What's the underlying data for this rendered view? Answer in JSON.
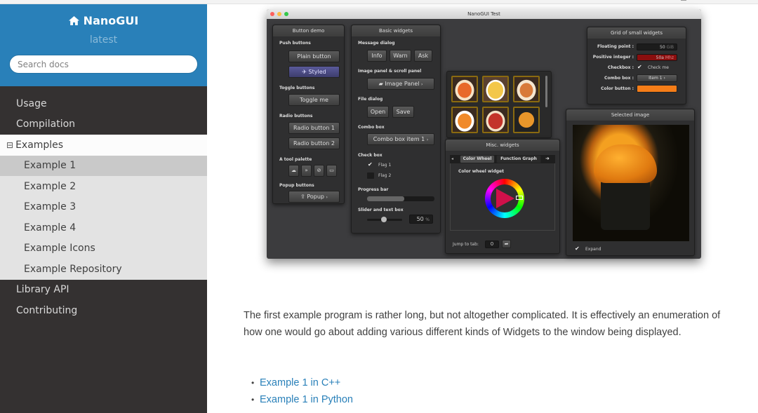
{
  "sidebar": {
    "project": "NanoGUI",
    "version": "latest",
    "search_placeholder": "Search docs",
    "items": [
      {
        "label": "Usage"
      },
      {
        "label": "Compilation"
      },
      {
        "label": "Examples"
      },
      {
        "label": "Library API"
      },
      {
        "label": "Contributing"
      }
    ],
    "sub_items": [
      {
        "label": "Example 1"
      },
      {
        "label": "Example 2"
      },
      {
        "label": "Example 3"
      },
      {
        "label": "Example 4"
      },
      {
        "label": "Example Icons"
      },
      {
        "label": "Example Repository"
      }
    ]
  },
  "screenshot": {
    "window_title": "NanoGUI Test",
    "button_demo": {
      "title": "Button demo",
      "push_label": "Push buttons",
      "plain": "Plain button",
      "styled": "Styled",
      "toggle_label": "Toggle buttons",
      "toggle": "Toggle me",
      "radio_label": "Radio buttons",
      "radio1": "Radio button 1",
      "radio2": "Radio button 2",
      "palette_label": "A tool palette",
      "popup_label": "Popup buttons",
      "popup": "Popup"
    },
    "basic_widgets": {
      "title": "Basic widgets",
      "msg_label": "Message dialog",
      "info": "Info",
      "warn": "Warn",
      "ask": "Ask",
      "image_label": "Image panel & scroll panel",
      "image_panel": "Image Panel",
      "file_label": "File dialog",
      "open": "Open",
      "save": "Save",
      "combo_label": "Combo box",
      "combo": "Combo box item 1",
      "check_label": "Check box",
      "flag1": "Flag 1",
      "flag2": "Flag 2",
      "progress_label": "Progress bar",
      "progress_value": 0.55,
      "slider_label": "Slider and text box",
      "slider_value": "50"
    },
    "misc": {
      "title": "Misc. widgets",
      "tab1": "Color Wheel",
      "tab2": "Function Graph",
      "wheel_label": "Color wheel widget",
      "jump": "Jump to tab:",
      "jump_value": "0"
    },
    "grid": {
      "title": "Grid of small widgets",
      "float_label": "Floating point :",
      "float_value": "50",
      "float_unit": "GiB",
      "int_label": "Positive integer :",
      "int_value": "50a",
      "int_unit": "Mhz",
      "check_label": "Checkbox :",
      "check_text": "Check me",
      "combo_label": "Combo box :",
      "combo_value": "Item 1",
      "color_label": "Color button :",
      "color": "#f57d18"
    },
    "selected": {
      "title": "Selected image",
      "expand": "Expand"
    }
  },
  "content": {
    "paragraph": "The first example program is rather long, but not altogether complicated. It is effectively an enumeration of how one would go about adding various different kinds of Widgets to the window being displayed.",
    "links": [
      "Example 1 in C++",
      "Example 1 in Python"
    ]
  },
  "colors": {
    "sidebar_head": "#2980b9",
    "sidebar_bg": "#343131",
    "link": "#2980b9"
  }
}
